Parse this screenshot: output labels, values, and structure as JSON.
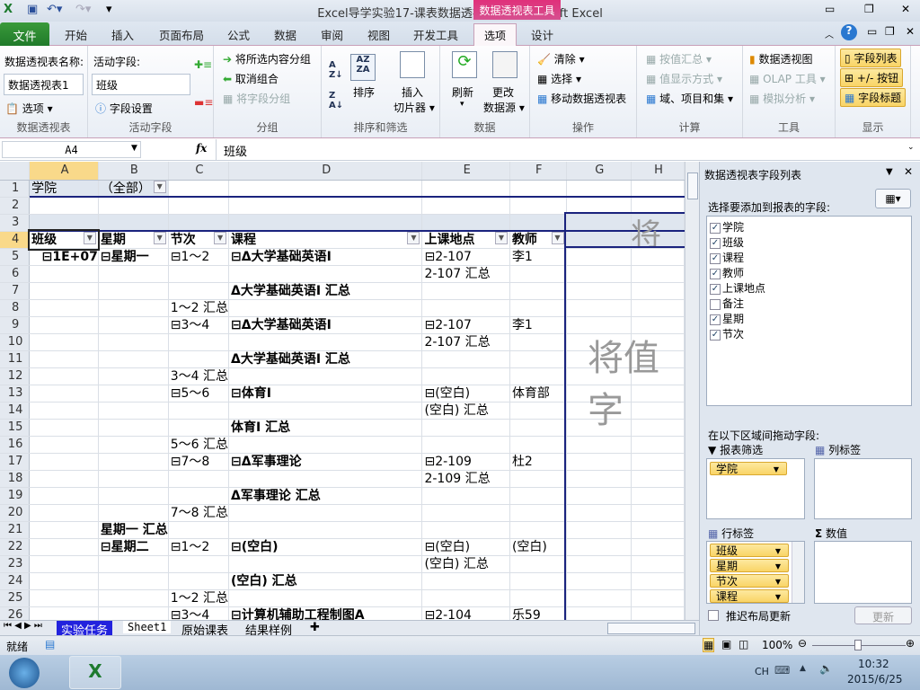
{
  "window": {
    "title": "Excel导学实验17-课表数据透视表1  -  Microsoft Excel",
    "context_tab": "数据透视表工具"
  },
  "tabs": [
    "文件",
    "开始",
    "插入",
    "页面布局",
    "公式",
    "数据",
    "审阅",
    "视图",
    "开发工具",
    "选项",
    "设计"
  ],
  "ribbon": {
    "pivot": {
      "name_label": "数据透视表名称:",
      "name_value": "数据透视表1",
      "options": "选项",
      "group": "数据透视表"
    },
    "active_field": {
      "label": "活动字段:",
      "value": "班级",
      "settings": "字段设置",
      "group": "活动字段"
    },
    "grouping": {
      "group_selection": "将所选内容分组",
      "ungroup": "取消组合",
      "group_field": "将字段分组",
      "group": "分组"
    },
    "sort": {
      "sort": "排序",
      "slicer": "插入\n切片器",
      "insert": "插入",
      "slicer2": "切片器",
      "group": "排序和筛选"
    },
    "data": {
      "refresh": "刷新",
      "change1": "更改",
      "change2": "数据源",
      "group": "数据"
    },
    "actions": {
      "clear": "清除",
      "select": "选择",
      "move": "移动数据透视表",
      "group": "操作"
    },
    "calc": {
      "summarize": "按值汇总",
      "show_as": "值显示方式",
      "fields": "域、项目和集",
      "group": "计算"
    },
    "tools": {
      "chart": "数据透视图",
      "olap": "OLAP 工具",
      "whatif": "模拟分析",
      "group": "工具"
    },
    "show": {
      "field_list": "字段列表",
      "buttons": "+/- 按钮",
      "headers": "字段标题",
      "group": "显示"
    }
  },
  "formula": {
    "cell": "A4",
    "fx": "fx",
    "value": "班级"
  },
  "columns": [
    "A",
    "B",
    "C",
    "D",
    "E",
    "F",
    "G",
    "H"
  ],
  "grid": {
    "rows": [
      [
        "学院",
        "（全部）",
        "",
        "",
        "",
        "",
        ""
      ],
      [
        "",
        "",
        "",
        "",
        "",
        "",
        ""
      ],
      [
        "",
        "",
        "",
        "",
        "",
        "",
        ""
      ],
      [
        "班级",
        "星期",
        "节次",
        "课程",
        "上课地点",
        "教师",
        ""
      ],
      [
        "⊟1E+07",
        "⊟星期一",
        "⊟1～2",
        "⊟Δ大学基础英语Ⅰ",
        "⊟2-107",
        "李1",
        ""
      ],
      [
        "",
        "",
        "",
        "",
        "2-107 汇总",
        "",
        ""
      ],
      [
        "",
        "",
        "",
        "Δ大学基础英语Ⅰ 汇总",
        "",
        "",
        ""
      ],
      [
        "",
        "",
        "1～2 汇总",
        "",
        "",
        "",
        ""
      ],
      [
        "",
        "",
        "⊟3～4",
        "⊟Δ大学基础英语Ⅰ",
        "⊟2-107",
        "李1",
        ""
      ],
      [
        "",
        "",
        "",
        "",
        "2-107 汇总",
        "",
        ""
      ],
      [
        "",
        "",
        "",
        "Δ大学基础英语Ⅰ 汇总",
        "",
        "",
        ""
      ],
      [
        "",
        "",
        "3～4 汇总",
        "",
        "",
        "",
        ""
      ],
      [
        "",
        "",
        "⊟5～6",
        "⊟体育Ⅰ",
        "⊟(空白)",
        "体育部",
        ""
      ],
      [
        "",
        "",
        "",
        "",
        "(空白) 汇总",
        "",
        ""
      ],
      [
        "",
        "",
        "",
        "体育Ⅰ 汇总",
        "",
        "",
        ""
      ],
      [
        "",
        "",
        "5～6 汇总",
        "",
        "",
        "",
        ""
      ],
      [
        "",
        "",
        "⊟7～8",
        "⊟Δ军事理论",
        "⊟2-109",
        "杜2",
        ""
      ],
      [
        "",
        "",
        "",
        "",
        "2-109 汇总",
        "",
        ""
      ],
      [
        "",
        "",
        "",
        "Δ军事理论 汇总",
        "",
        "",
        ""
      ],
      [
        "",
        "",
        "7～8 汇总",
        "",
        "",
        "",
        ""
      ],
      [
        "",
        "星期一 汇总",
        "",
        "",
        "",
        "",
        ""
      ],
      [
        "",
        "⊟星期二",
        "⊟1～2",
        "⊟(空白)",
        "⊟(空白)",
        "(空白)",
        ""
      ],
      [
        "",
        "",
        "",
        "",
        "(空白) 汇总",
        "",
        ""
      ],
      [
        "",
        "",
        "",
        "(空白) 汇总",
        "",
        "",
        ""
      ],
      [
        "",
        "",
        "1～2 汇总",
        "",
        "",
        "",
        ""
      ],
      [
        "",
        "",
        "⊟3～4",
        "⊟计算机辅助工程制图A",
        "⊟2-104",
        "乐59",
        ""
      ]
    ],
    "col_drop_hint": "将列",
    "value_drop_hint": "将值字"
  },
  "sheets": [
    "实验任务",
    "Sheet1",
    "原始课表",
    "结果样例"
  ],
  "status": {
    "ready": "就绪",
    "zoom": "100%"
  },
  "field_list": {
    "title": "数据透视表字段列表",
    "choose_label": "选择要添加到报表的字段:",
    "fields": [
      {
        "name": "学院",
        "checked": true
      },
      {
        "name": "班级",
        "checked": true
      },
      {
        "name": "课程",
        "checked": true
      },
      {
        "name": "教师",
        "checked": true
      },
      {
        "name": "上课地点",
        "checked": true
      },
      {
        "name": "备注",
        "checked": false
      },
      {
        "name": "星期",
        "checked": true
      },
      {
        "name": "节次",
        "checked": true
      }
    ],
    "drag_label": "在以下区域间拖动字段:",
    "report_filter": "报表筛选",
    "column_labels": "列标签",
    "row_labels": "行标签",
    "values": "数值",
    "filter_items": [
      "学院"
    ],
    "row_items": [
      "班级",
      "星期",
      "节次",
      "课程"
    ],
    "defer": "推迟布局更新",
    "update": "更新"
  },
  "taskbar": {
    "lang": "CH",
    "time": "10:32",
    "date": "2015/6/25"
  }
}
